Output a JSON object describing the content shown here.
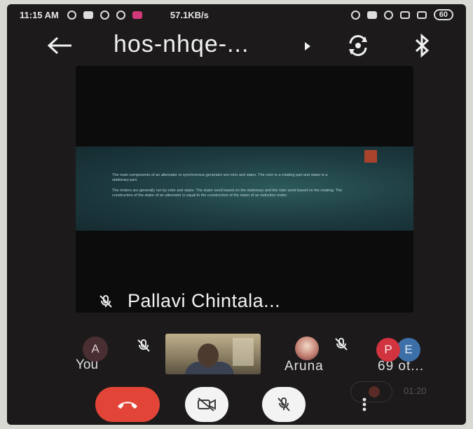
{
  "status_bar": {
    "time": "11:15 AM",
    "network_speed": "57.1KB/s",
    "battery": "60"
  },
  "header": {
    "meeting_code": "hos-nhqe-..."
  },
  "main_tile": {
    "presenter_name": "Pallavi Chintala...",
    "slide_bullets": [
      "The main components of an alternator or synchronous generator are rotor and stator. The rotor is a rotating part and stator is a stationary part.",
      "The motors are generally run by rotor and stator. The stator word based on the stationary and the rotor word based on the rotating. The construction of the stator of an alternator is equal to the construction of the stator of an induction motor."
    ]
  },
  "participants": {
    "you_initial": "A",
    "you_label": "You",
    "aruna_label": "Aruna",
    "others_initials": [
      "P",
      "E"
    ],
    "others_label": "69 ot..."
  },
  "controls": {
    "record_time": "01:20"
  },
  "colors": {
    "end_call": "#e24538",
    "avatar_p": "#d1333f",
    "avatar_e": "#3d6fa8",
    "background": "#1c1a1a"
  }
}
